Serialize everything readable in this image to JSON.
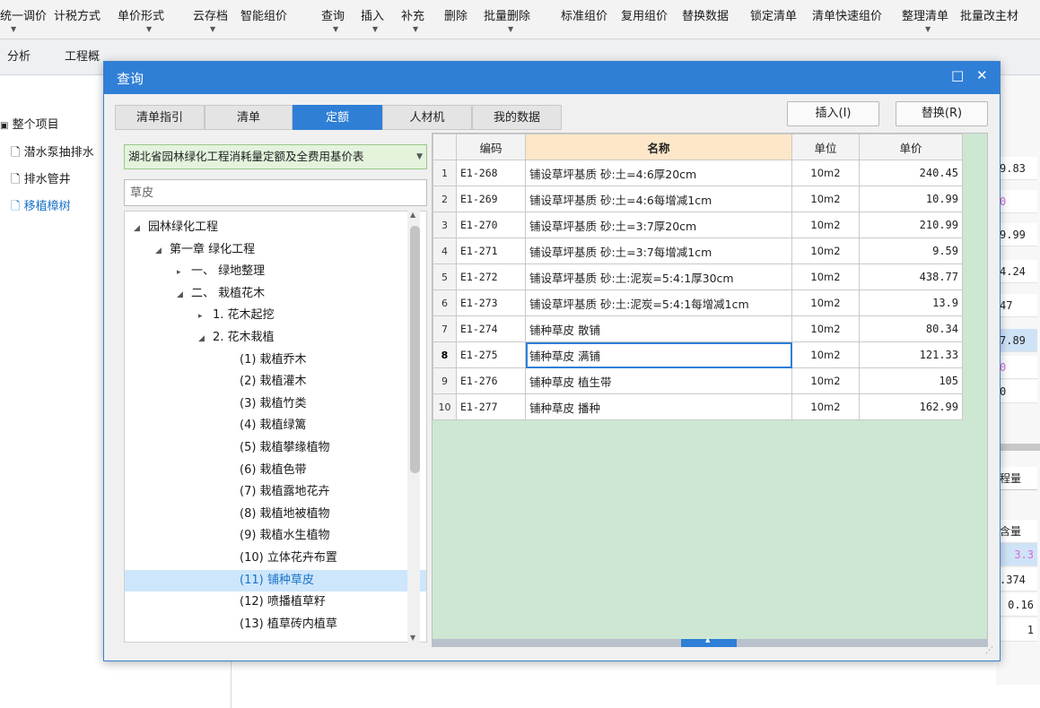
{
  "toolbar": {
    "items": [
      "统一调价",
      "计税方式",
      "单价形式",
      "云存档",
      "智能组价",
      "查询",
      "插入",
      "补充",
      "删除",
      "批量删除",
      "标准组价",
      "复用组价",
      "替换数据",
      "锁定清单",
      "清单快速组价",
      "整理清单",
      "批量改主材"
    ]
  },
  "background": {
    "tabs": [
      "分析",
      "工程概"
    ],
    "tree": [
      "整个项目",
      "潜水泵抽排水",
      "排水管井",
      "移植樟树"
    ],
    "right_values": [
      "9.83",
      "0",
      "9.99",
      "4.24",
      "47",
      "7.89",
      "0",
      "0",
      "",
      "",
      "3.3",
      ".374",
      "0.16",
      "1"
    ],
    "right_labels": [
      "程量",
      "含量"
    ]
  },
  "dialog": {
    "title": "查询",
    "controls": {
      "maximize": "□",
      "close": "✕"
    },
    "tabs": [
      "清单指引",
      "清单",
      "定额",
      "人材机",
      "我的数据"
    ],
    "active_tab": 2,
    "buttons": {
      "insert": "插入(I)",
      "replace": "替换(R)"
    },
    "library": "湖北省园林绿化工程消耗量定额及全费用基价表",
    "search": {
      "value": "",
      "placeholder": "草皮"
    },
    "tree": [
      {
        "label": "园林绿化工程",
        "level": 0,
        "expander": "◢"
      },
      {
        "label": "第一章 绿化工程",
        "level": 1,
        "expander": "◢"
      },
      {
        "label": "一、 绿地整理",
        "level": 2,
        "expander": "▸"
      },
      {
        "label": "二、 栽植花木",
        "level": 2,
        "expander": "◢"
      },
      {
        "label": "1. 花木起挖",
        "level": 3,
        "expander": "▸"
      },
      {
        "label": "2. 花木栽植",
        "level": 3,
        "expander": "◢"
      },
      {
        "label": "(1) 栽植乔木",
        "level": 4,
        "expander": ""
      },
      {
        "label": "(2) 栽植灌木",
        "level": 4,
        "expander": ""
      },
      {
        "label": "(3) 栽植竹类",
        "level": 4,
        "expander": ""
      },
      {
        "label": "(4) 栽植绿篱",
        "level": 4,
        "expander": ""
      },
      {
        "label": "(5) 栽植攀缘植物",
        "level": 4,
        "expander": ""
      },
      {
        "label": "(6) 栽植色带",
        "level": 4,
        "expander": ""
      },
      {
        "label": "(7) 栽植露地花卉",
        "level": 4,
        "expander": ""
      },
      {
        "label": "(8) 栽植地被植物",
        "level": 4,
        "expander": ""
      },
      {
        "label": "(9) 栽植水生植物",
        "level": 4,
        "expander": ""
      },
      {
        "label": "(10) 立体花卉布置",
        "level": 4,
        "expander": ""
      },
      {
        "label": "(11) 铺种草皮",
        "level": 4,
        "expander": "",
        "selected": true
      },
      {
        "label": "(12) 喷播植草籽",
        "level": 4,
        "expander": ""
      },
      {
        "label": "(13) 植草砖内植草",
        "level": 4,
        "expander": ""
      }
    ],
    "table": {
      "headers": [
        "编码",
        "名称",
        "单位",
        "单价"
      ],
      "current_row": 8,
      "rows": [
        {
          "no": "1",
          "code": "E1-268",
          "name": "铺设草坪基质 砂:土=4:6厚20cm",
          "unit": "10m2",
          "price": "240.45"
        },
        {
          "no": "2",
          "code": "E1-269",
          "name": "铺设草坪基质 砂:土=4:6每增减1cm",
          "unit": "10m2",
          "price": "10.99"
        },
        {
          "no": "3",
          "code": "E1-270",
          "name": "铺设草坪基质 砂:土=3:7厚20cm",
          "unit": "10m2",
          "price": "210.99"
        },
        {
          "no": "4",
          "code": "E1-271",
          "name": "铺设草坪基质 砂:土=3:7每增减1cm",
          "unit": "10m2",
          "price": "9.59"
        },
        {
          "no": "5",
          "code": "E1-272",
          "name": "铺设草坪基质 砂:土:泥炭=5:4:1厚30cm",
          "unit": "10m2",
          "price": "438.77"
        },
        {
          "no": "6",
          "code": "E1-273",
          "name": "铺设草坪基质 砂:土:泥炭=5:4:1每增减1cm",
          "unit": "10m2",
          "price": "13.9"
        },
        {
          "no": "7",
          "code": "E1-274",
          "name": "铺种草皮 散铺",
          "unit": "10m2",
          "price": "80.34"
        },
        {
          "no": "8",
          "code": "E1-275",
          "name": "铺种草皮 满铺",
          "unit": "10m2",
          "price": "121.33"
        },
        {
          "no": "9",
          "code": "E1-276",
          "name": "铺种草皮 植生带",
          "unit": "10m2",
          "price": "105"
        },
        {
          "no": "10",
          "code": "E1-277",
          "name": "铺种草皮 播种",
          "unit": "10m2",
          "price": "162.99"
        }
      ]
    }
  },
  "colors": {
    "accent": "#2f7fd6",
    "grid_bg": "#cde7d3",
    "header_name": "#fde7c8",
    "tree_sel": "#cde6fb",
    "dropdown_bg": "#e3f3dc"
  }
}
